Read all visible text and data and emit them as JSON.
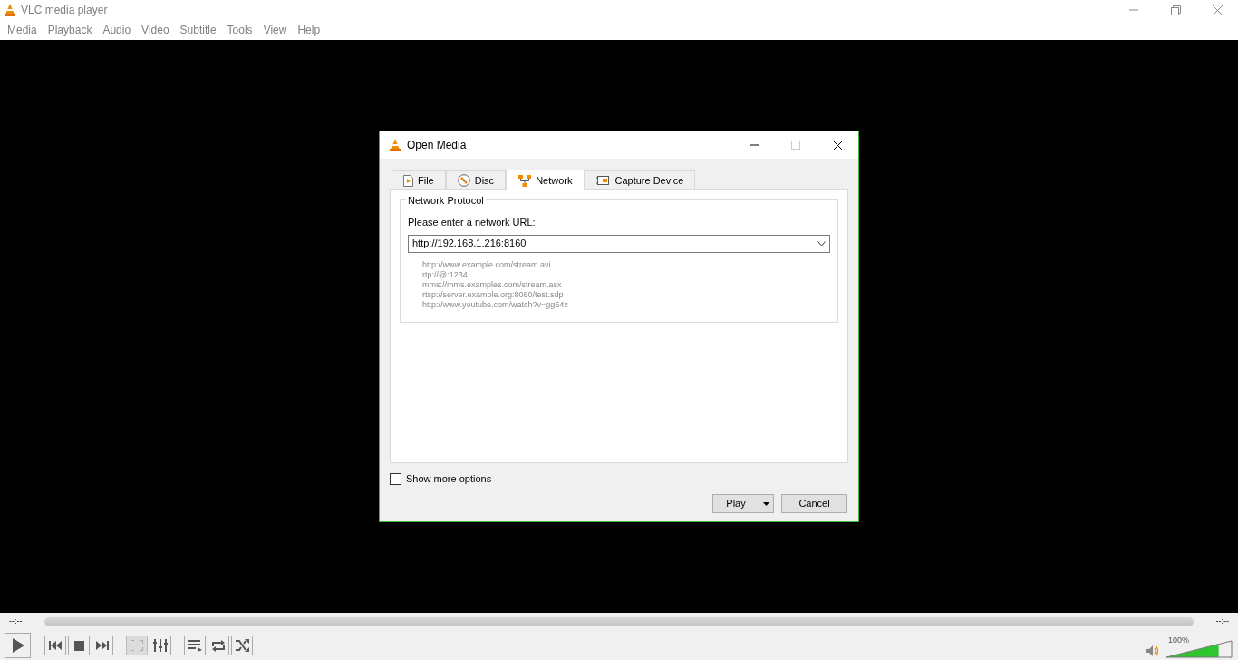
{
  "window": {
    "title": "VLC media player"
  },
  "menu": [
    "Media",
    "Playback",
    "Audio",
    "Video",
    "Subtitle",
    "Tools",
    "View",
    "Help"
  ],
  "dialog": {
    "title": "Open Media",
    "tabs": [
      {
        "label": "File",
        "selected": false
      },
      {
        "label": "Disc",
        "selected": false
      },
      {
        "label": "Network",
        "selected": true
      },
      {
        "label": "Capture Device",
        "selected": false
      }
    ],
    "group_title": "Network Protocol",
    "url_label": "Please enter a network URL:",
    "url_value": "http://192.168.1.216:8160",
    "examples": [
      "http://www.example.com/stream.avi",
      "rtp://@:1234",
      "mms://mms.examples.com/stream.asx",
      "rtsp://server.example.org:8080/test.sdp",
      "http://www.youtube.com/watch?v=gg64x"
    ],
    "show_more_options": {
      "label": "Show more options",
      "checked": false
    },
    "buttons": {
      "play": "Play",
      "cancel": "Cancel"
    }
  },
  "player": {
    "elapsed": "--:--",
    "remaining": "--:--",
    "volume": {
      "reading": "100%",
      "level": 0.8
    }
  }
}
